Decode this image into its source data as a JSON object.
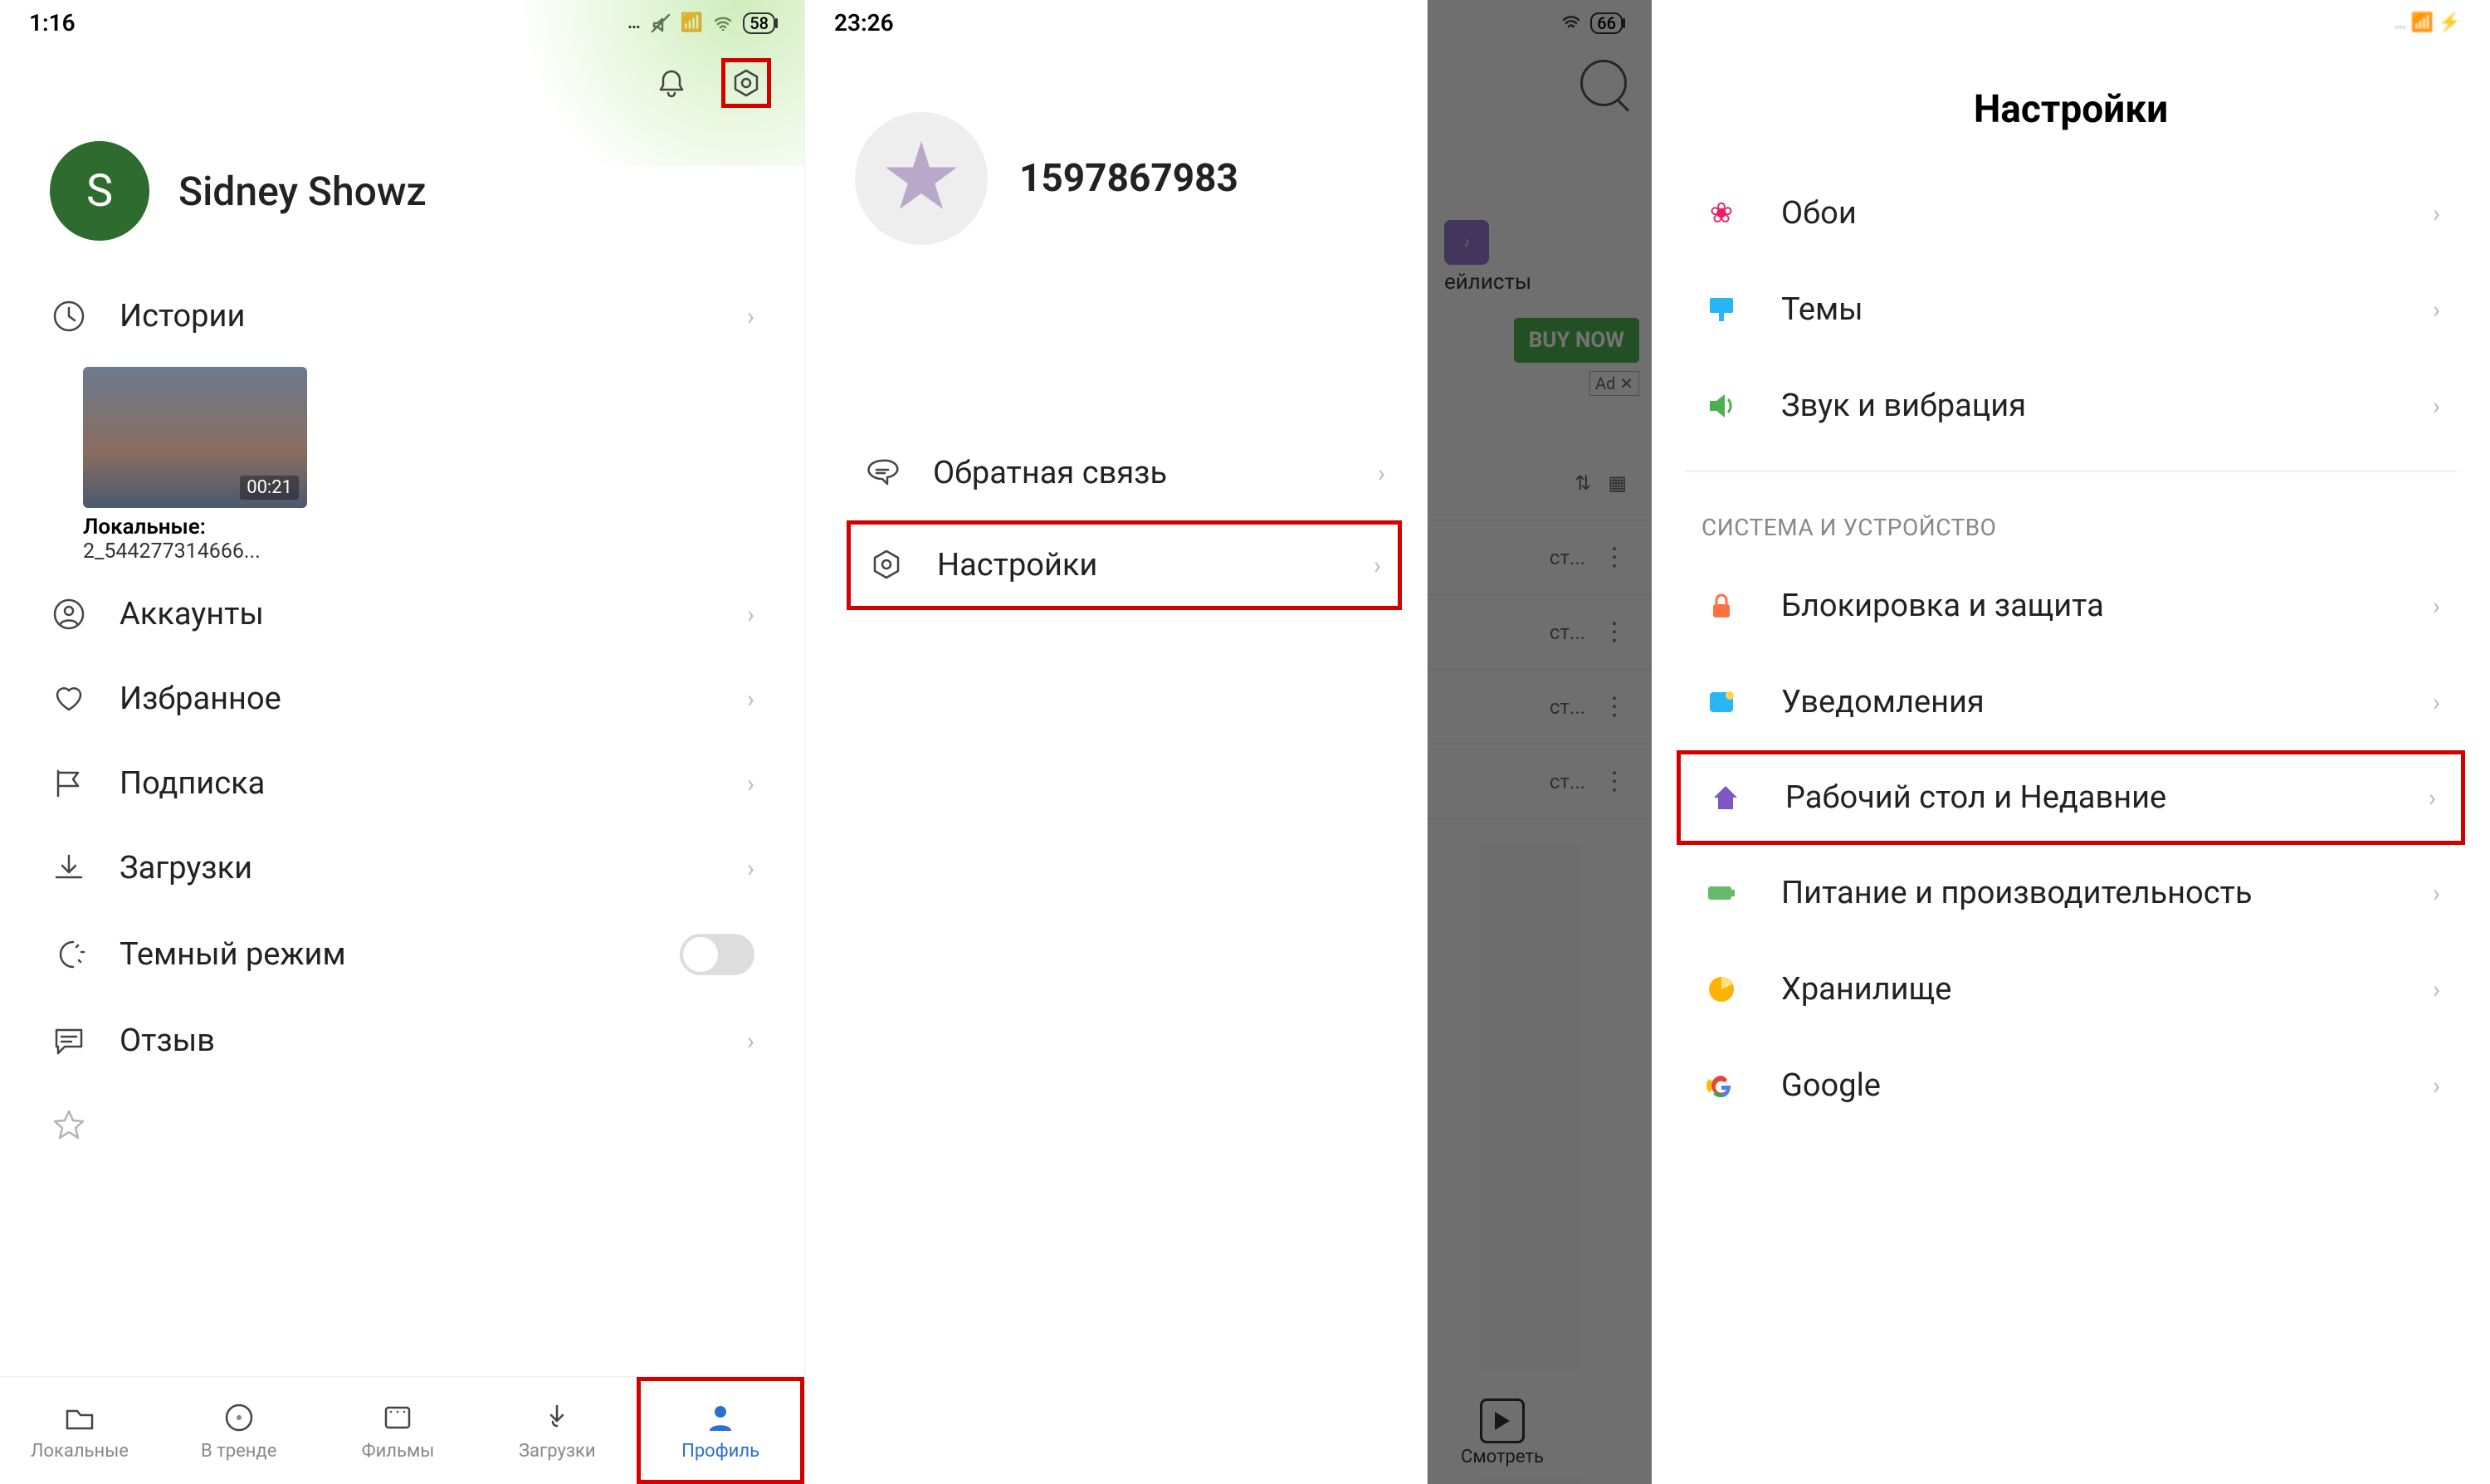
{
  "screen1": {
    "status": {
      "time": "1:16",
      "battery": "58"
    },
    "username": "Sidney Showz",
    "avatar_letter": "S",
    "menu": {
      "history": "Истории",
      "story": {
        "duration": "00:21",
        "cap1": "Локальные:",
        "cap2": "2_544277314666..."
      },
      "accounts": "Аккаунты",
      "favorites": "Избранное",
      "subscription": "Подписка",
      "downloads": "Загрузки",
      "dark_mode": "Темный режим",
      "feedback": "Отзыв"
    },
    "bottomnav": {
      "local": "Локальные",
      "trending": "В тренде",
      "movies": "Фильмы",
      "downloads": "Загрузки",
      "profile": "Профиль"
    }
  },
  "screen2": {
    "status": {
      "time": "23:26"
    },
    "username": "1597867983",
    "menu": {
      "feedback": "Обратная связь",
      "settings": "Настройки"
    }
  },
  "screen3": {
    "status": {
      "battery": "66"
    },
    "chip_label": "ейлисты",
    "buy": "BUY NOW",
    "ad": "Ad ✕",
    "rowtext": "ст...",
    "bottom": "Смотреть"
  },
  "screen4": {
    "title": "Настройки",
    "items": {
      "wallpaper": "Обои",
      "themes": "Темы",
      "sound": "Звук и вибрация"
    },
    "category": "СИСТЕМА И УСТРОЙСТВО",
    "system": {
      "lock": "Блокировка и защита",
      "notifications": "Уведомления",
      "home": "Рабочий стол и Недавние",
      "power": "Питание и производительность",
      "storage": "Хранилище",
      "google": "Google"
    }
  }
}
